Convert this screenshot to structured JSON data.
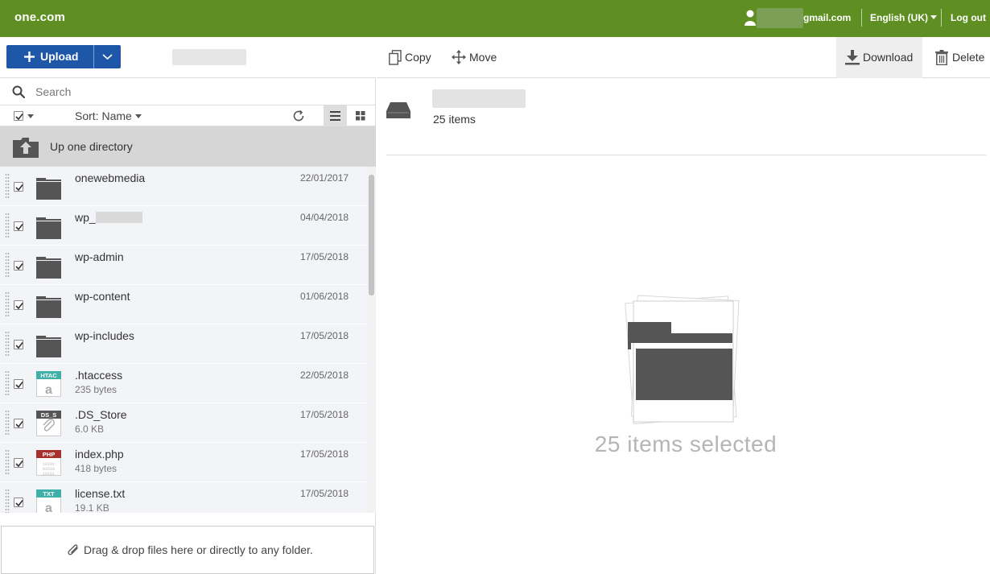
{
  "header": {
    "logo": "one.com",
    "user_email": "gmail.com",
    "language": "English (UK)",
    "logout": "Log out",
    "brand_color": "#5f8f22"
  },
  "left_toolbar": {
    "upload_label": "Upload",
    "upload_color": "#1e57a8"
  },
  "search": {
    "placeholder": "Search",
    "value": ""
  },
  "list_toolbar": {
    "sort_label": "Sort: Name",
    "view_mode": "list"
  },
  "up_directory": {
    "label": "Up one directory"
  },
  "files": [
    {
      "name": "onewebmedia",
      "name_suffix": "",
      "masked": false,
      "size": "",
      "date": "22/01/2017",
      "type": "folder",
      "checked": true
    },
    {
      "name": "wp_",
      "name_suffix": "",
      "masked": true,
      "size": "",
      "date": "04/04/2018",
      "type": "folder",
      "checked": true
    },
    {
      "name": "wp-admin",
      "name_suffix": "",
      "masked": false,
      "size": "",
      "date": "17/05/2018",
      "type": "folder",
      "checked": true
    },
    {
      "name": "wp-content",
      "name_suffix": "",
      "masked": false,
      "size": "",
      "date": "01/06/2018",
      "type": "folder",
      "checked": true
    },
    {
      "name": "wp-includes",
      "name_suffix": "",
      "masked": false,
      "size": "",
      "date": "17/05/2018",
      "type": "folder",
      "checked": true
    },
    {
      "name": ".htaccess",
      "name_suffix": "",
      "masked": false,
      "size": "235 bytes",
      "date": "22/05/2018",
      "type": "file",
      "badge": "HTAC",
      "badge_color": "#3fb0a8",
      "glyph": "a",
      "checked": true
    },
    {
      "name": ".DS_Store",
      "name_suffix": "",
      "masked": false,
      "size": "6.0 KB",
      "date": "17/05/2018",
      "type": "file",
      "badge": "DS_S",
      "badge_color": "#555555",
      "glyph": "clip",
      "checked": true
    },
    {
      "name": "index.php",
      "name_suffix": "",
      "masked": false,
      "size": "418 bytes",
      "date": "17/05/2018",
      "type": "file",
      "badge": "PHP",
      "badge_color": "#a8302c",
      "glyph": "binary",
      "checked": true
    },
    {
      "name": "license.txt",
      "name_suffix": "",
      "masked": false,
      "size": "19.1 KB",
      "date": "17/05/2018",
      "type": "file",
      "badge": "TXT",
      "badge_color": "#3fb0a8",
      "glyph": "a",
      "checked": true
    }
  ],
  "dropzone": {
    "text": "Drag & drop files here or directly to any folder."
  },
  "right_toolbar": {
    "copy_label": "Copy",
    "move_label": "Move",
    "download_label": "Download",
    "delete_label": "Delete"
  },
  "summary": {
    "count_text": "25 items"
  },
  "selection": {
    "text": "25 items selected"
  }
}
